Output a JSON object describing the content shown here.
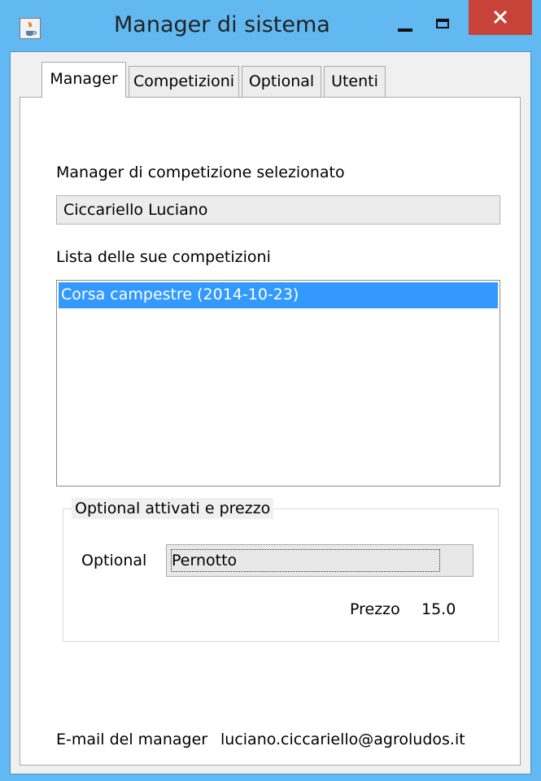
{
  "window": {
    "title": "Manager di sistema",
    "icon": "java-cup-icon"
  },
  "tabs": [
    {
      "label": "Manager",
      "active": true
    },
    {
      "label": "Competizioni",
      "active": false
    },
    {
      "label": "Optional",
      "active": false
    },
    {
      "label": "Utenti",
      "active": false
    }
  ],
  "manager_panel": {
    "selected_manager_label": "Manager di competizione selezionato",
    "selected_manager_value": "Ciccariello Luciano",
    "competitions_label": "Lista delle sue competizioni",
    "competitions": [
      {
        "text": "Corsa campestre (2014-10-23)",
        "selected": true
      }
    ],
    "optional_group": {
      "title": "Optional attivati e prezzo",
      "optional_label": "Optional",
      "optional_selected": "Pernotto",
      "price_label": "Prezzo",
      "price_value": "15.0"
    },
    "email_label": "E-mail del manager",
    "email_value": "luciano.ciccariello@agroludos.it"
  },
  "colors": {
    "title_bar": "#62b9f1",
    "close_button": "#c7433a",
    "selection": "#3399ff",
    "panel_background": "#f0f0f0"
  }
}
